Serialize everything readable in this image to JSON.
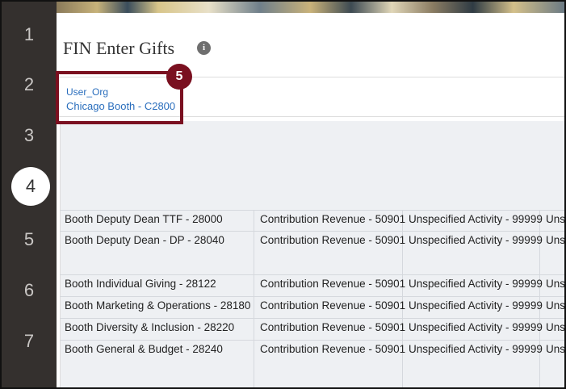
{
  "steps": [
    "1",
    "2",
    "3",
    "4",
    "5",
    "6",
    "7"
  ],
  "active_step": "4",
  "page": {
    "title": "FIN Enter Gifts",
    "info_icon": "info-icon"
  },
  "filter": {
    "label": "User_Org",
    "value": "Chicago Booth - C2800"
  },
  "callout": {
    "number": "5",
    "color": "#7a1020"
  },
  "rows": [
    {
      "org": "Booth Deputy Dean TTF - 28000",
      "account": "Contribution Revenue - 50901",
      "activity": "Unspecified Activity - 99999",
      "next": "Uns"
    },
    {
      "org": "Booth Deputy Dean - DP - 28040",
      "account": "Contribution Revenue - 50901",
      "activity": "Unspecified Activity - 99999",
      "next": "Uns"
    },
    {
      "org": "Booth Individual Giving - 28122",
      "account": "Contribution Revenue - 50901",
      "activity": "Unspecified Activity - 99999",
      "next": "Uns"
    },
    {
      "org": "Booth Marketing & Operations - 28180",
      "account": "Contribution Revenue - 50901",
      "activity": "Unspecified Activity - 99999",
      "next": "Uns"
    },
    {
      "org": "Booth Diversity & Inclusion - 28220",
      "account": "Contribution Revenue - 50901",
      "activity": "Unspecified Activity - 99999",
      "next": "Uns"
    },
    {
      "org": "Booth General & Budget - 28240",
      "account": "Contribution Revenue - 50901",
      "activity": "Unspecified Activity - 99999",
      "next": "Uns"
    }
  ]
}
